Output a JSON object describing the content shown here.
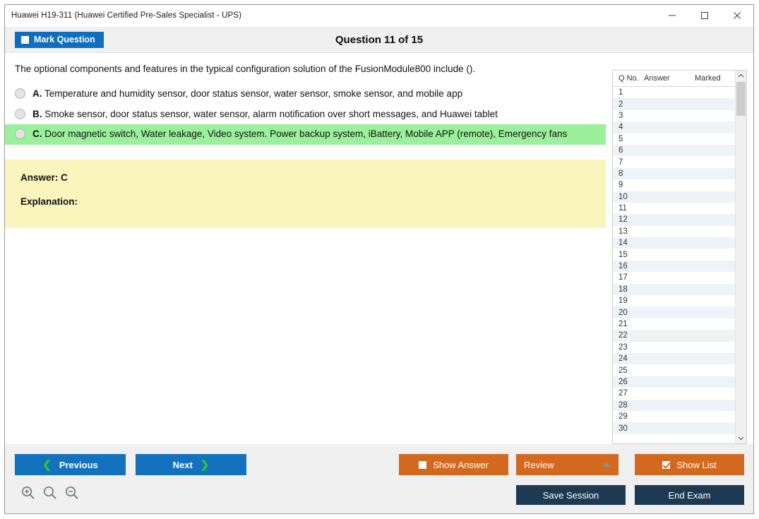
{
  "window": {
    "title": "Huawei H19-311 (Huawei Certified Pre-Sales Specialist - UPS)",
    "controls": {
      "minimize": "minimize-icon",
      "maximize": "maximize-icon",
      "close": "close-icon"
    }
  },
  "toolbar": {
    "mark_question_label": "Mark Question",
    "mark_question_checked": false,
    "question_header": "Question 11 of 15"
  },
  "question": {
    "text": "The optional components and features in the typical configuration solution of the FusionModule800 include ().",
    "options": [
      {
        "letter": "A.",
        "text": "Temperature and humidity sensor, door status sensor, water sensor, smoke sensor, and mobile app",
        "selected": false,
        "highlighted": false
      },
      {
        "letter": "B.",
        "text": "Smoke sensor, door status sensor, water sensor, alarm notification over short messages, and Huawei tablet",
        "selected": false,
        "highlighted": false
      },
      {
        "letter": "C.",
        "text": "Door magnetic switch, Water leakage, Video system. Power backup system, iBattery, Mobile APP (remote), Emergency fans",
        "selected": false,
        "highlighted": true
      }
    ]
  },
  "answer_panel": {
    "answer_label": "Answer: C",
    "explanation_label": "Explanation:"
  },
  "question_list": {
    "columns": [
      "Q No.",
      "Answer",
      "Marked"
    ],
    "rows": [
      {
        "no": "1",
        "answer": "",
        "marked": ""
      },
      {
        "no": "2",
        "answer": "",
        "marked": ""
      },
      {
        "no": "3",
        "answer": "",
        "marked": ""
      },
      {
        "no": "4",
        "answer": "",
        "marked": ""
      },
      {
        "no": "5",
        "answer": "",
        "marked": ""
      },
      {
        "no": "6",
        "answer": "",
        "marked": ""
      },
      {
        "no": "7",
        "answer": "",
        "marked": ""
      },
      {
        "no": "8",
        "answer": "",
        "marked": ""
      },
      {
        "no": "9",
        "answer": "",
        "marked": ""
      },
      {
        "no": "10",
        "answer": "",
        "marked": ""
      },
      {
        "no": "11",
        "answer": "",
        "marked": ""
      },
      {
        "no": "12",
        "answer": "",
        "marked": ""
      },
      {
        "no": "13",
        "answer": "",
        "marked": ""
      },
      {
        "no": "14",
        "answer": "",
        "marked": ""
      },
      {
        "no": "15",
        "answer": "",
        "marked": ""
      },
      {
        "no": "16",
        "answer": "",
        "marked": ""
      },
      {
        "no": "17",
        "answer": "",
        "marked": ""
      },
      {
        "no": "18",
        "answer": "",
        "marked": ""
      },
      {
        "no": "19",
        "answer": "",
        "marked": ""
      },
      {
        "no": "20",
        "answer": "",
        "marked": ""
      },
      {
        "no": "21",
        "answer": "",
        "marked": ""
      },
      {
        "no": "22",
        "answer": "",
        "marked": ""
      },
      {
        "no": "23",
        "answer": "",
        "marked": ""
      },
      {
        "no": "24",
        "answer": "",
        "marked": ""
      },
      {
        "no": "25",
        "answer": "",
        "marked": ""
      },
      {
        "no": "26",
        "answer": "",
        "marked": ""
      },
      {
        "no": "27",
        "answer": "",
        "marked": ""
      },
      {
        "no": "28",
        "answer": "",
        "marked": ""
      },
      {
        "no": "29",
        "answer": "",
        "marked": ""
      },
      {
        "no": "30",
        "answer": "",
        "marked": ""
      }
    ]
  },
  "footer": {
    "previous_label": "Previous",
    "next_label": "Next",
    "show_answer_label": "Show Answer",
    "show_answer_checked": false,
    "review_label": "Review",
    "show_list_label": "Show List",
    "show_list_checked": true,
    "save_session_label": "Save Session",
    "end_exam_label": "End Exam",
    "zoom_icons": [
      "zoom-in-icon",
      "zoom-reset-icon",
      "zoom-out-icon"
    ]
  },
  "colors": {
    "accent_blue": "#1272bd",
    "accent_orange": "#d2691e",
    "dark_navy": "#1e3a52",
    "highlight_green": "#9bf09b",
    "answer_yellow": "#faf4bd",
    "chevron_green": "#32c832"
  }
}
